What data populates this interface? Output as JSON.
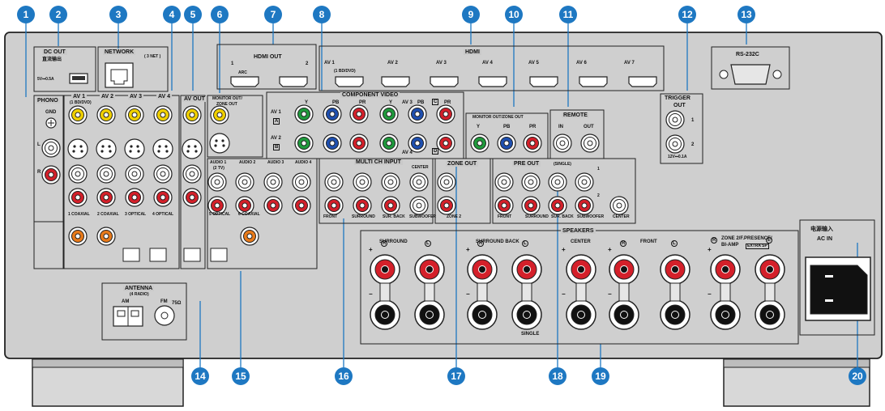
{
  "callouts": [
    "1",
    "2",
    "3",
    "4",
    "5",
    "6",
    "7",
    "8",
    "9",
    "10",
    "11",
    "12",
    "13",
    "14",
    "15",
    "16",
    "17",
    "18",
    "19",
    "20"
  ],
  "colors": {
    "callout": "#1e78c2",
    "panel": "#c9c9c9",
    "jack_yellow": "#f0d000",
    "jack_red": "#d4202a",
    "jack_green": "#1f9a3c",
    "jack_blue": "#1e4fb0",
    "jack_orange": "#e87a1a"
  },
  "labels": {
    "dc_out": "DC OUT",
    "dc_out_cn": "直流输出",
    "dc_spec": "5V⎓0.5A",
    "network": "NETWORK",
    "network_sub": "( 3 NET )",
    "hdmi_out": "HDMI OUT",
    "hdmi_out_1": "1",
    "hdmi_out_2": "2",
    "arc": "ARC",
    "hdmi": "HDMI",
    "hdmi_av1": "AV 1",
    "hdmi_av1_sub": "(1 BD/DVD)",
    "hdmi_av2": "AV 2",
    "hdmi_av3": "AV 3",
    "hdmi_av4": "AV 4",
    "hdmi_av5": "AV 5",
    "hdmi_av6": "AV 6",
    "hdmi_av7": "AV 7",
    "rs232c": "RS-232C",
    "phono": "PHONO",
    "gnd": "GND",
    "phono_l": "L",
    "phono_r": "R",
    "av1": "AV 1",
    "av1_sub": "(1 BD/DVD)",
    "av2": "AV 2",
    "av3": "AV 3",
    "av4": "AV 4",
    "av_out": "AV OUT",
    "monitor_out": "MONITOR OUT/",
    "zone_out": "ZONE OUT",
    "component_video": "COMPONENT VIDEO",
    "cv_y": "Y",
    "cv_pb": "PB",
    "cv_pr": "PR",
    "cv_av1": "AV 1",
    "cv_a": "A",
    "cv_av2": "AV 2",
    "cv_b": "B",
    "cv_av3": "AV 3",
    "cv_c": "C",
    "cv_av4": "AV 4",
    "cv_d": "D",
    "mo_zone": "MONITOR OUT/ZONE OUT",
    "mo_y": "Y",
    "mo_pb": "PB",
    "mo_pr": "PR",
    "remote": "REMOTE",
    "remote_in": "IN",
    "remote_out": "OUT",
    "trigger_out": "TRIGGER",
    "trigger_out2": "OUT",
    "trigger_1": "1",
    "trigger_2": "2",
    "trigger_spec": "12V⎓0.1A",
    "coax_1": "1 COAXIAL",
    "coax_2": "2 COAXIAL",
    "optical_3": "3 OPTICAL",
    "optical_4": "4 OPTICAL",
    "optical_5": "5 OPTICAL",
    "coax_6": "6 COAXIAL",
    "audio1": "AUDIO 1",
    "audio1_sub": "(2 TV)",
    "audio2": "AUDIO 2",
    "audio3": "AUDIO 3",
    "audio4": "AUDIO 4",
    "multi_ch": "MULTI CH INPUT",
    "mc_center": "CENTER",
    "mc_front": "FRONT",
    "mc_surround": "SURROUND",
    "mc_surback": "SUR. BACK",
    "mc_subwoofer": "SUBWOOFER",
    "zone_out2": "ZONE OUT",
    "zone_2": "ZONE 2",
    "pre_out": "PRE OUT",
    "pre_single": "(SINGLE)",
    "pre_1": "1",
    "pre_2": "2",
    "po_front": "FRONT",
    "po_surround": "SURROUND",
    "po_surback": "SUR. BACK",
    "po_subwoofer": "SUBWOOFER",
    "po_center": "CENTER",
    "antenna": "ANTENNA",
    "antenna_sub": "(4 RADIO)",
    "am": "AM",
    "fm": "FM",
    "fm_ohm": "75Ω",
    "speakers": "SPEAKERS",
    "sp_surround": "SURROUND",
    "sp_surback": "SURROUND BACK",
    "sp_center": "CENTER",
    "sp_front": "FRONT",
    "sp_zone": "ZONE 2/F.PRESENCE/",
    "sp_biamp": "BI-AMP",
    "sp_extra": "EXTRA SP",
    "sp_single": "SINGLE",
    "sp_r": "R",
    "sp_l": "L",
    "plus": "+",
    "minus": "−",
    "ac_in_cn": "电源输入",
    "ac_in": "AC IN"
  }
}
